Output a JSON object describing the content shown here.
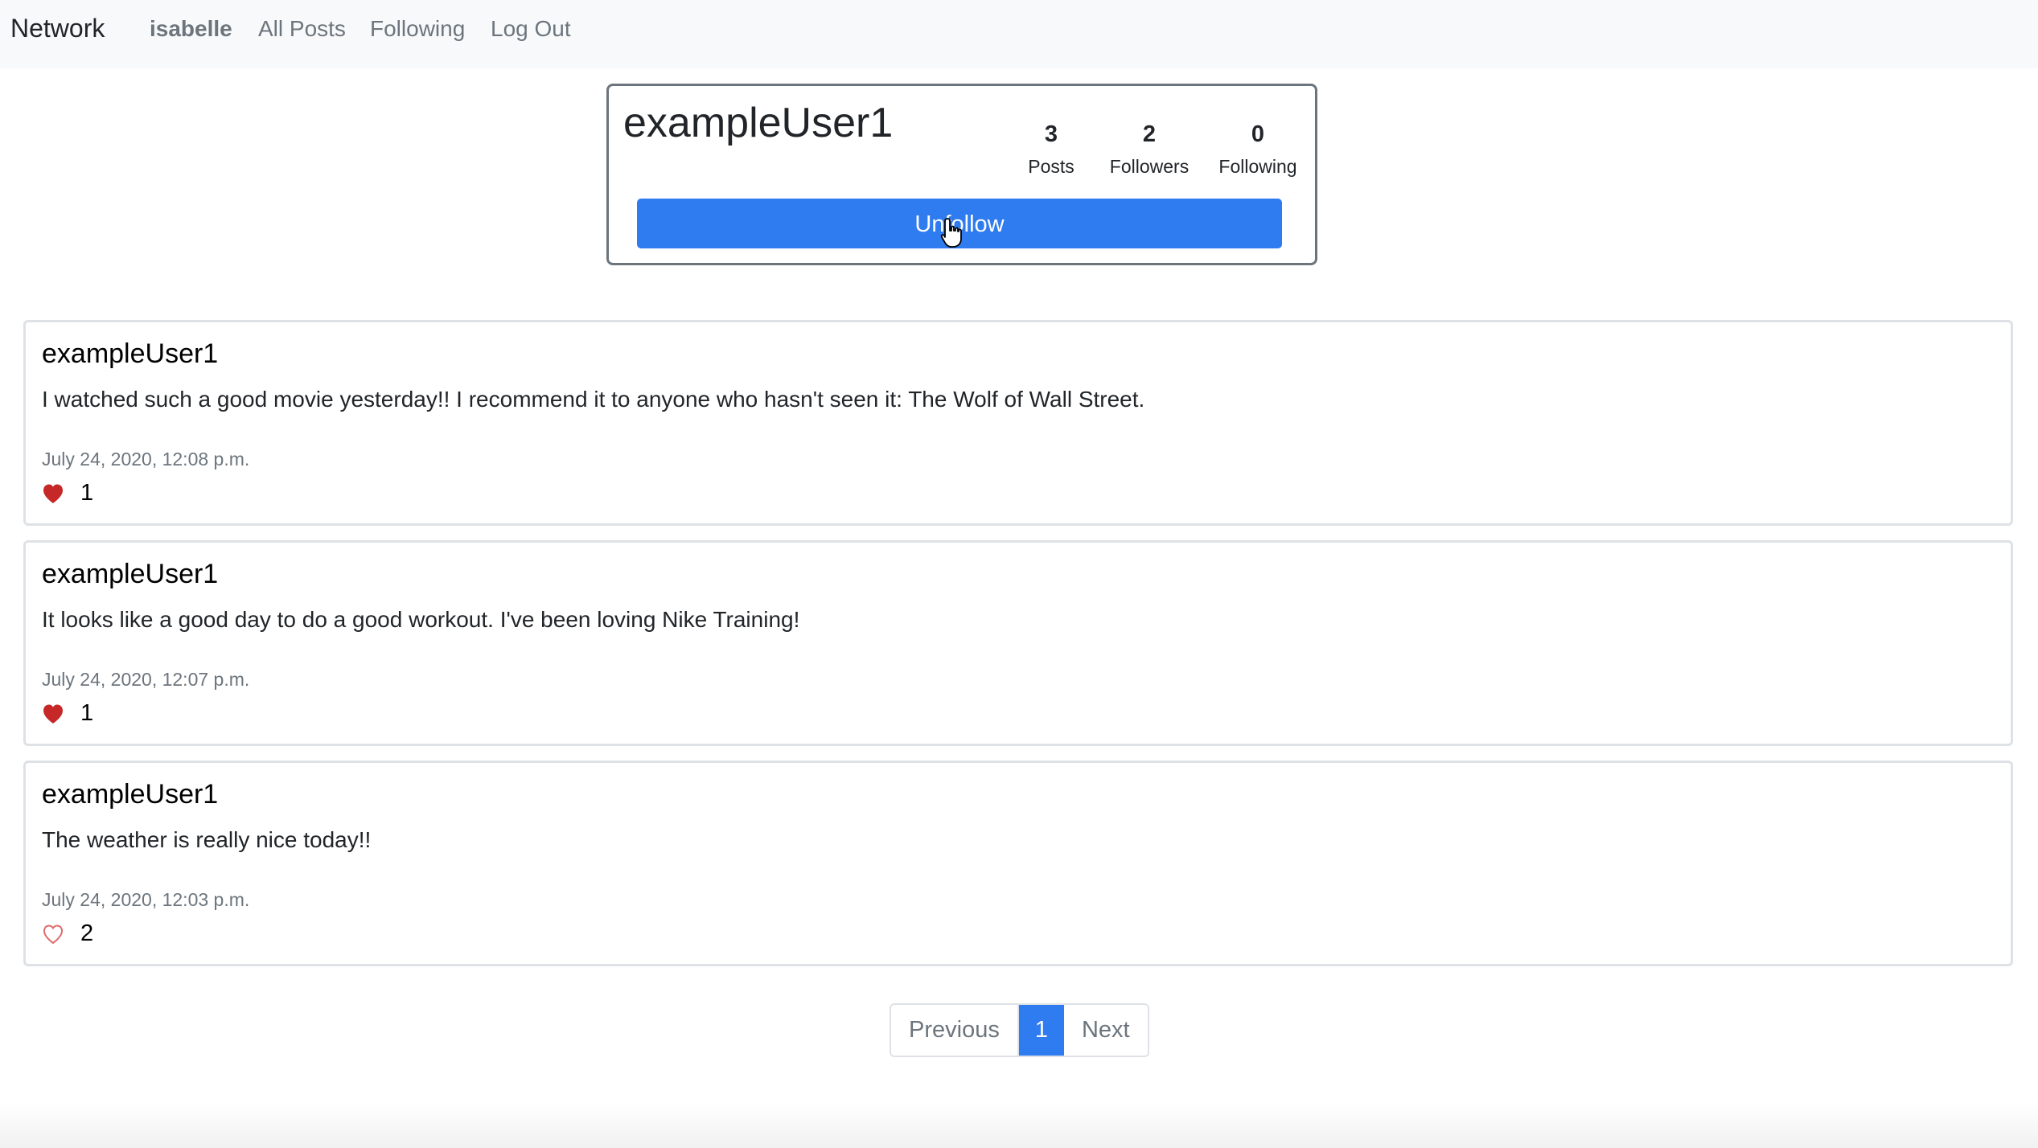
{
  "navbar": {
    "brand": "Network",
    "user": "isabelle",
    "all_posts": "All Posts",
    "following": "Following",
    "logout": "Log Out"
  },
  "profile": {
    "username": "exampleUser1",
    "stats": {
      "posts": {
        "value": "3",
        "label": "Posts"
      },
      "followers": {
        "value": "2",
        "label": "Followers"
      },
      "following": {
        "value": "0",
        "label": "Following"
      }
    },
    "button_label": "Unfollow"
  },
  "posts": [
    {
      "author": "exampleUser1",
      "content": "I watched such a good movie yesterday!! I recommend it to anyone who hasn't seen it: The Wolf of Wall Street.",
      "timestamp": "July 24, 2020, 12:08 p.m.",
      "likes": "1",
      "liked": true
    },
    {
      "author": "exampleUser1",
      "content": "It looks like a good day to do a good workout. I've been loving Nike Training!",
      "timestamp": "July 24, 2020, 12:07 p.m.",
      "likes": "1",
      "liked": true
    },
    {
      "author": "exampleUser1",
      "content": "The weather is really nice today!!",
      "timestamp": "July 24, 2020, 12:03 p.m.",
      "likes": "2",
      "liked": false
    }
  ],
  "pagination": {
    "previous": "Previous",
    "current": "1",
    "next": "Next"
  },
  "colors": {
    "accent": "#2f7bf0",
    "heart_filled": "#c62828",
    "heart_outline": "#e06a6a"
  },
  "icons": {
    "like_filled": "heart-filled-icon",
    "like_outline": "heart-outline-icon",
    "cursor": "hand-pointer-cursor-icon"
  }
}
